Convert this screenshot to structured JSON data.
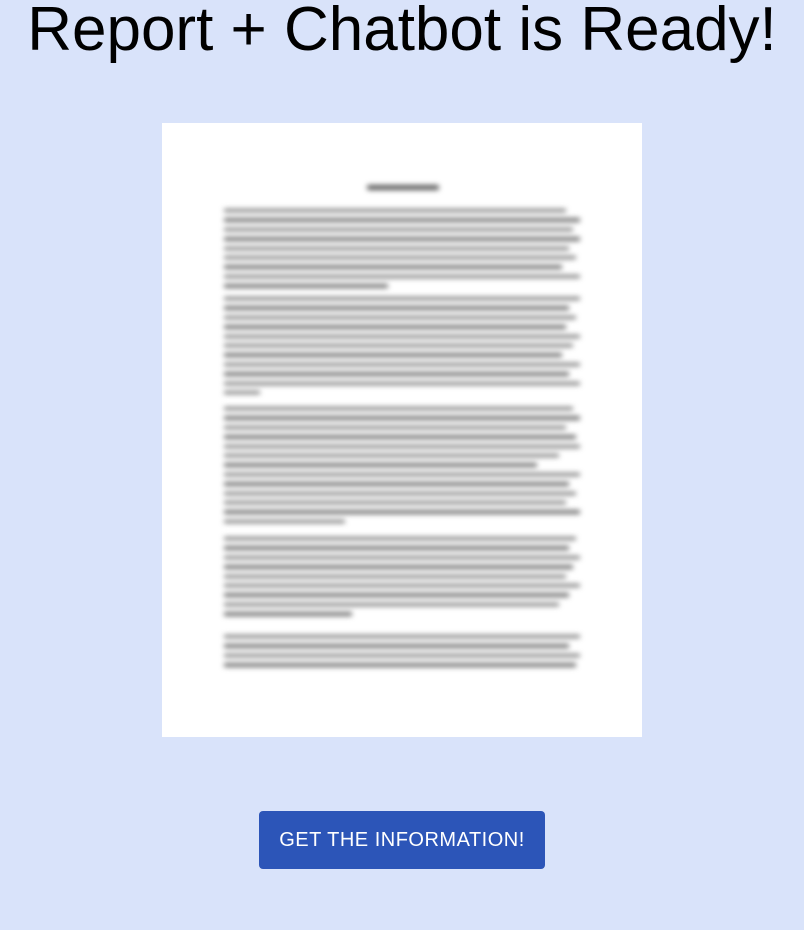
{
  "page": {
    "title": "Report + Chatbot is Ready!",
    "background_color": "#d9e3fa"
  },
  "report_preview": {
    "icon": "blurred-document-thumbnail"
  },
  "cta": {
    "label": "GET THE INFORMATION!",
    "color": "#2c55b8",
    "text_color": "#ffffff"
  }
}
